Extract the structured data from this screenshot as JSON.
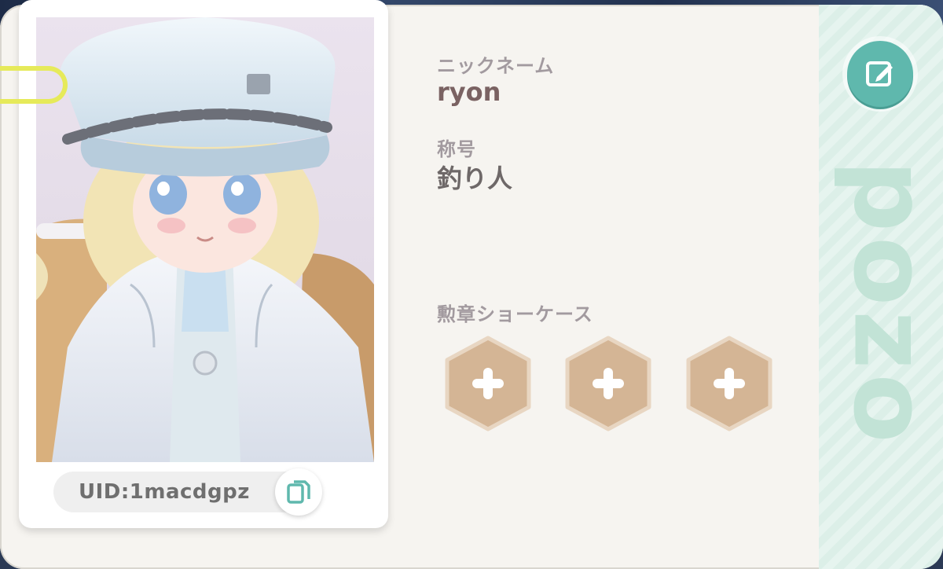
{
  "profile": {
    "nickname_label": "ニックネーム",
    "nickname": "ryon",
    "title_label": "称号",
    "title": "釣り人",
    "badge_showcase_label": "勲章ショーケース",
    "uid": "UID:1macdgpz",
    "side_text": "pozo"
  },
  "badges": [
    {
      "state": "empty",
      "icon": "plus-icon"
    },
    {
      "state": "empty",
      "icon": "plus-icon"
    },
    {
      "state": "empty",
      "icon": "plus-icon"
    }
  ],
  "icons": {
    "edit": "edit-icon",
    "copy": "copy-icon",
    "clip": "paperclip-icon"
  },
  "colors": {
    "card_bg": "#f6f4f0",
    "accent_teal": "#5fb8ad",
    "stripe_green": "#dcefe8",
    "badge_tan": "#d4b595",
    "nickname_color": "#7a6262",
    "label_color": "#a29a9f"
  }
}
